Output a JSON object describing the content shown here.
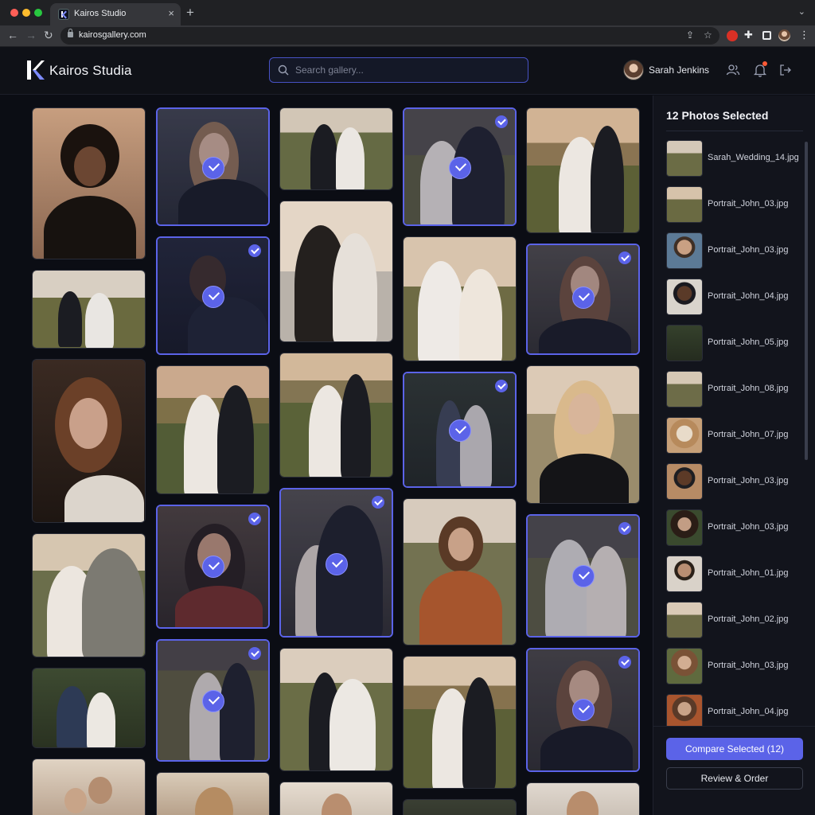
{
  "browser": {
    "tab_title": "Kairos Studio",
    "url": "kairosgallery.com"
  },
  "header": {
    "brand": "Kairos Studia",
    "search_placeholder": "Search gallery...",
    "user_name": "Sarah Jenkins",
    "icons": [
      "search-icon",
      "users-icon",
      "bell-icon",
      "logout-icon"
    ]
  },
  "gallery": {
    "photos": [
      {
        "id": "c1-1",
        "selected": false
      },
      {
        "id": "c1-2",
        "selected": false
      },
      {
        "id": "c1-3",
        "selected": false
      },
      {
        "id": "c1-4",
        "selected": false
      },
      {
        "id": "c1-5",
        "selected": false
      },
      {
        "id": "c1-6",
        "selected": false
      },
      {
        "id": "c2-1",
        "selected": true
      },
      {
        "id": "c2-2",
        "selected": true
      },
      {
        "id": "c2-3",
        "selected": false
      },
      {
        "id": "c2-4",
        "selected": true
      },
      {
        "id": "c2-5",
        "selected": true
      },
      {
        "id": "c2-6",
        "selected": false
      },
      {
        "id": "c3-1",
        "selected": false
      },
      {
        "id": "c3-2",
        "selected": false
      },
      {
        "id": "c3-3",
        "selected": false
      },
      {
        "id": "c3-4",
        "selected": true
      },
      {
        "id": "c3-5",
        "selected": false
      },
      {
        "id": "c3-6",
        "selected": false
      },
      {
        "id": "c4-1",
        "selected": true
      },
      {
        "id": "c4-2",
        "selected": false
      },
      {
        "id": "c4-3",
        "selected": true
      },
      {
        "id": "c4-4",
        "selected": false
      },
      {
        "id": "c4-5",
        "selected": false
      },
      {
        "id": "c4-6",
        "selected": false
      },
      {
        "id": "c5-1",
        "selected": false
      },
      {
        "id": "c5-2",
        "selected": true
      },
      {
        "id": "c5-3",
        "selected": false
      },
      {
        "id": "c5-4",
        "selected": true
      },
      {
        "id": "c5-5",
        "selected": true
      },
      {
        "id": "c5-6",
        "selected": false
      }
    ]
  },
  "panel": {
    "title": "12 Photos Selected",
    "items": [
      {
        "name": "Sarah_Wedding_14.jpg"
      },
      {
        "name": "Portrait_John_03.jpg"
      },
      {
        "name": "Portrait_John_03.jpg"
      },
      {
        "name": "Portrait_John_04.jpg"
      },
      {
        "name": "Portrait_John_05.jpg"
      },
      {
        "name": "Portrait_John_08.jpg"
      },
      {
        "name": "Portrait_John_07.jpg"
      },
      {
        "name": "Portrait_John_03.jpg"
      },
      {
        "name": "Portrait_John_03.jpg"
      },
      {
        "name": "Portrait_John_01.jpg"
      },
      {
        "name": "Portrait_John_02.jpg"
      },
      {
        "name": "Portrait_John_03.jpg"
      },
      {
        "name": "Portrait_John_04.jpg"
      }
    ],
    "compare_label": "Compare Selected (12)",
    "review_label": "Review & Order"
  },
  "colors": {
    "accent": "#5b63e8",
    "background": "#0b0d14",
    "panel": "#12141c"
  }
}
